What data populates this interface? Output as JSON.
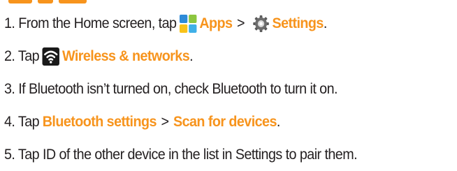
{
  "colors": {
    "highlight": "#f7941d",
    "text": "#231f20"
  },
  "icons": [
    "apps-icon",
    "settings-gear-icon",
    "wifi-icon"
  ],
  "steps": [
    {
      "lead": "1. From the Home screen, tap",
      "apps": "Apps",
      "sep": ">",
      "settings": "Settings",
      "end": "."
    },
    {
      "lead": "2. Tap",
      "wireless": "Wireless & networks",
      "end": "."
    },
    {
      "text": "3. If Bluetooth isn’t turned on, check Bluetooth to turn it on."
    },
    {
      "lead": "4. Tap",
      "bt_settings": "Bluetooth settings",
      "sep": ">",
      "scan": "Scan for devices",
      "end": "."
    },
    {
      "text": "5. Tap ID of the other device in the list in Settings to pair them."
    }
  ]
}
